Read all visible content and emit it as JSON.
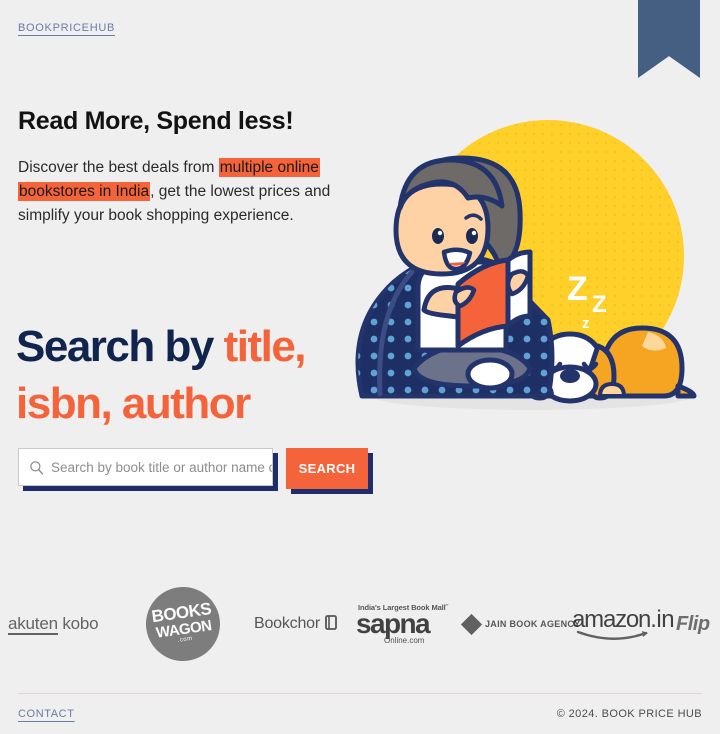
{
  "theme": {
    "background": "#efefef",
    "accent_orange": "#f4633a",
    "navy": "#10244e",
    "shadow_navy": "#1f2d6b",
    "slate_blue": "#455f82",
    "link_blue": "#6b7ba3",
    "illustration_yellow": "#ffcf2a"
  },
  "header": {
    "logo": "BOOKPRICEHUB",
    "ribbon_icon": "bookmark-ribbon"
  },
  "hero": {
    "title": "Read More, Spend less!",
    "description_part1": "Discover the best deals from ",
    "description_highlight": "multiple online bookstores in India",
    "description_part2": ", get the lowest prices and simplify your book shopping experience.",
    "big_headline_prefix": "Search by ",
    "big_headline_accent": "title, isbn, author"
  },
  "search": {
    "icon": "search-icon",
    "placeholder": "Search by book title or author name or ISBN",
    "value": "",
    "button_label": "SEARCH"
  },
  "illustration": {
    "name": "girl-reading-book-with-sleeping-dog",
    "sleep_text": "Zzz"
  },
  "partners": [
    {
      "name": "rakuten-kobo",
      "text_a": "akuten",
      "text_b": " kobo"
    },
    {
      "name": "bookswagon",
      "line1": "BOOKS",
      "line2": "WAGON",
      "line3": ".com"
    },
    {
      "name": "bookchor",
      "text": "Bookchor",
      "mark": "☰"
    },
    {
      "name": "sapna-online",
      "tagline": "India's Largest Book Mall˝",
      "main": "sapna",
      "sub": "Online.com"
    },
    {
      "name": "jain-book-agency",
      "text": "JAIN BOOK AGENCY"
    },
    {
      "name": "amazon-in",
      "text": "amazon",
      "suffix": ".in"
    },
    {
      "name": "flipkart",
      "text": "Flip"
    }
  ],
  "footer": {
    "contact": "CONTACT",
    "copyright": "© 2024. BOOK PRICE HUB"
  }
}
